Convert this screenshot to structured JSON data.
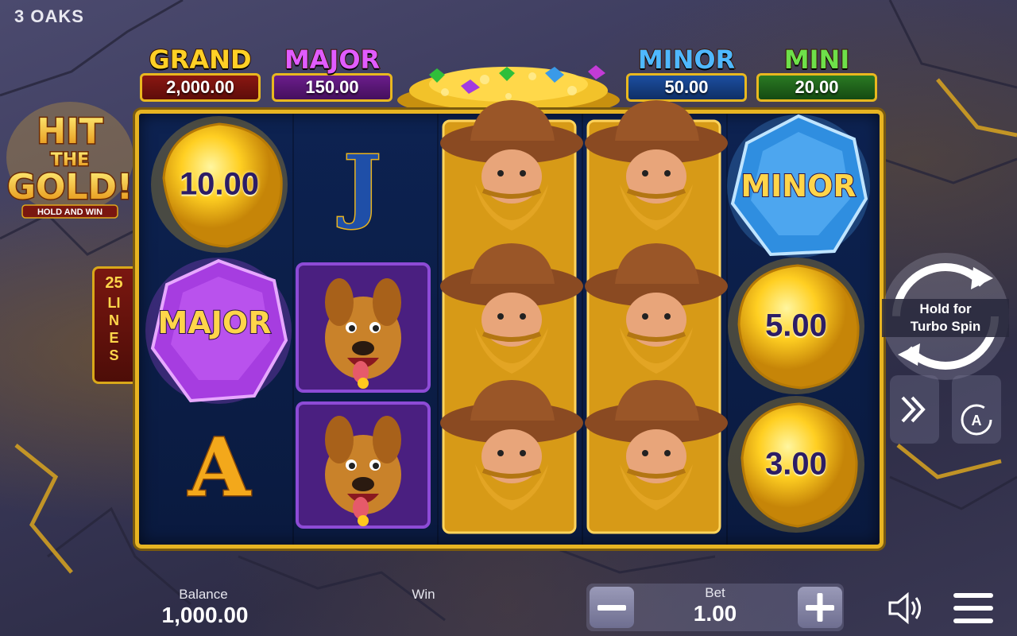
{
  "brand": "3 OAKS",
  "game": {
    "logo_line1": "HIT",
    "logo_line2": "THE",
    "logo_line3": "GOLD!",
    "logo_tagline": "HOLD AND WIN"
  },
  "jackpots": [
    {
      "name": "GRAND",
      "value": "2,000.00",
      "color": "#ffd026"
    },
    {
      "name": "MAJOR",
      "value": "150.00",
      "color": "#e05cff"
    },
    {
      "name": "MINOR",
      "value": "50.00",
      "color": "#4fb8ff"
    },
    {
      "name": "MINI",
      "value": "20.00",
      "color": "#6ee04a"
    }
  ],
  "lines": {
    "count": "25",
    "word": "LINES"
  },
  "reels": {
    "gold_value_1": "10.00",
    "gold_value_2": "5.00",
    "gold_value_3": "3.00",
    "gem_major_label": "MAJOR",
    "gem_minor_label": "MINOR",
    "card_j": "J",
    "card_a": "A"
  },
  "controls": {
    "turbo_line1": "Hold for",
    "turbo_line2": "Turbo Spin"
  },
  "bottom": {
    "balance_label": "Balance",
    "balance_value": "1,000.00",
    "win_label": "Win",
    "bet_label": "Bet",
    "bet_value": "1.00"
  },
  "icons": {
    "sound": "speaker-icon",
    "menu": "hamburger-menu-icon",
    "fast": "fast-forward-icon",
    "auto": "autoplay-icon",
    "spin": "spin-arrows-icon"
  }
}
